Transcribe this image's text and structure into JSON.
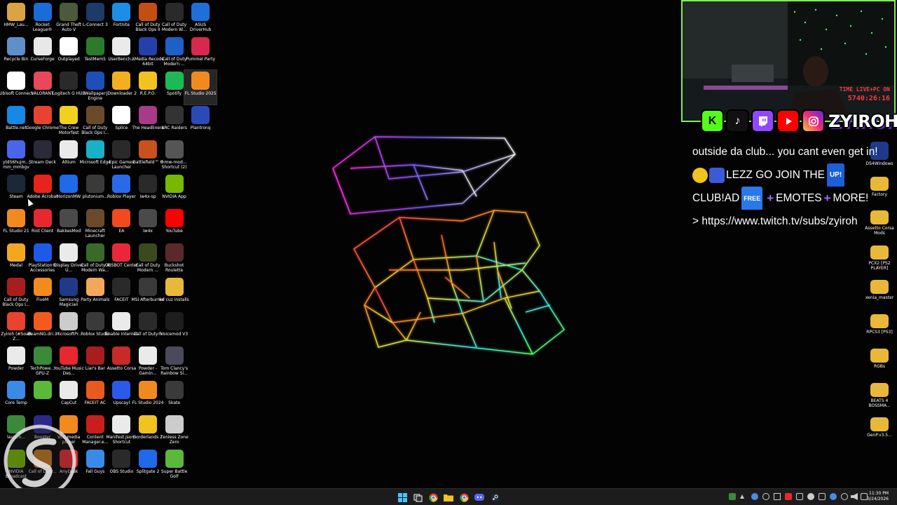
{
  "desktop_icons": [
    {
      "label": "HMW_Lau...",
      "icon": "folder-icon",
      "color": "#d9a441"
    },
    {
      "label": "Rocket League®",
      "icon": "rocket-league-icon",
      "color": "#1a6cd8"
    },
    {
      "label": "Grand Theft Auto V",
      "icon": "gta-icon",
      "color": "#4a5a3a"
    },
    {
      "label": "L-Connect 3",
      "icon": "lconnect-icon",
      "color": "#1e3a66"
    },
    {
      "label": "Fortnite",
      "icon": "fortnite-icon",
      "color": "#1b8fe8"
    },
    {
      "label": "Call of Duty Black Ops II",
      "icon": "cod-bo2-icon",
      "color": "#c44e12"
    },
    {
      "label": "Call of Duty Modern W...",
      "icon": "cod-mw-icon",
      "color": "#2a2a2a"
    },
    {
      "label": "ASUS DriverHub",
      "icon": "asus-icon",
      "color": "#1f6fd8"
    },
    {
      "label": "Recycle Bin",
      "icon": "recycle-bin-icon",
      "color": "#5f8fc8"
    },
    {
      "label": "CurseForge",
      "icon": "curseforge-icon",
      "color": "#e8e8e8"
    },
    {
      "label": "Outplayed",
      "icon": "outplayed-icon",
      "color": "#ffffff"
    },
    {
      "label": "TestMem5",
      "icon": "testmem-icon",
      "color": "#2d7a2d"
    },
    {
      "label": "UserBench...",
      "icon": "userbench-icon",
      "color": "#eaeaea"
    },
    {
      "label": "XMedia Recode 64bit",
      "icon": "xmedia-icon",
      "color": "#2540a8"
    },
    {
      "label": "Call of Duty Modern ...",
      "icon": "cod-icon",
      "color": "#1f5fc8"
    },
    {
      "label": "Pummel Party",
      "icon": "pummel-party-icon",
      "color": "#d8284f"
    },
    {
      "label": "Ubisoft Connect",
      "icon": "ubisoft-icon",
      "color": "#ffffff"
    },
    {
      "label": "VALORANT",
      "icon": "valorant-icon",
      "color": "#e8485a"
    },
    {
      "label": "Logitech G HUB",
      "icon": "ghub-icon",
      "color": "#2a2a2a"
    },
    {
      "label": "Wallpaper Engine",
      "icon": "wallpaper-engine-icon",
      "color": "#1e4fb8"
    },
    {
      "label": "JDownloader 2",
      "icon": "jdownloader-icon",
      "color": "#f2b01e"
    },
    {
      "label": "R.E.P.O.",
      "icon": "repo-icon",
      "color": "#f2c21e"
    },
    {
      "label": "Spotify",
      "icon": "spotify-icon",
      "color": "#1db954"
    },
    {
      "label": "FL Studio 2025",
      "icon": "fl-studio-icon",
      "color": "#f08a1e"
    },
    {
      "label": "Battle.net",
      "icon": "battlenet-icon",
      "color": "#1588e8"
    },
    {
      "label": "Google Chrome",
      "icon": "chrome-icon",
      "color": "#e8432e"
    },
    {
      "label": "The Crew Motorfest",
      "icon": "crew-icon",
      "color": "#f2d01e"
    },
    {
      "label": "Call of Duty Black Ops I...",
      "icon": "cod-bo-icon",
      "color": "#6a4a2a"
    },
    {
      "label": "Splice",
      "icon": "splice-icon",
      "color": "#ffffff"
    },
    {
      "label": "The Headliners",
      "icon": "headliners-icon",
      "color": "#a83a8a"
    },
    {
      "label": "ARC Raiders",
      "icon": "arc-raiders-icon",
      "color": "#333333"
    },
    {
      "label": "Plantronq",
      "icon": "plantronq-icon",
      "color": "#2a4ab8"
    },
    {
      "label": "ytd56hujm... mm_mmbgv",
      "icon": "folder-icon",
      "color": "#4a66e8"
    },
    {
      "label": "Stream Deck",
      "icon": "stream-deck-icon",
      "color": "#2a2a3a"
    },
    {
      "label": "Altium",
      "icon": "altium-icon",
      "color": "#eaeaea"
    },
    {
      "label": "Microsoft Edge",
      "icon": "edge-icon",
      "color": "#1ab0c8"
    },
    {
      "label": "Epic Games Launcher",
      "icon": "epic-icon",
      "color": "#2a2a2a"
    },
    {
      "label": "Battlefield™ 6",
      "icon": "battlefield-icon",
      "color": "#c8521e"
    },
    {
      "label": "hmw-mod... Shortcut (2)",
      "icon": "hmw-icon",
      "color": "#555555"
    },
    {
      "label": "Steam",
      "icon": "steam-icon",
      "color": "#1b2838"
    },
    {
      "label": "Adobe Acrobat",
      "icon": "acrobat-icon",
      "color": "#e8231e"
    },
    {
      "label": "HorizonMW",
      "icon": "horizon-icon",
      "color": "#1e6ae8"
    },
    {
      "label": "plutonium...",
      "icon": "plutonium-icon",
      "color": "#3a3a3a"
    },
    {
      "label": "Roblox Player",
      "icon": "roblox-icon",
      "color": "#2a6ae8"
    },
    {
      "label": "iw4x-sp",
      "icon": "iw4x-icon",
      "color": "#2a2a2a"
    },
    {
      "label": "NVIDIA App",
      "icon": "nvidia-icon",
      "color": "#76b900"
    },
    {
      "label": "FL Studio 21",
      "icon": "fl-studio-icon",
      "color": "#f08a1e"
    },
    {
      "label": "Riot Client",
      "icon": "riot-icon",
      "color": "#e8282e"
    },
    {
      "label": "BakkesMod",
      "icon": "bakkesmod-icon",
      "color": "#4a4a4a"
    },
    {
      "label": "Minecraft Launcher",
      "icon": "minecraft-icon",
      "color": "#6a4a2a"
    },
    {
      "label": "EA",
      "icon": "ea-icon",
      "color": "#f04a1e"
    },
    {
      "label": "iw4x",
      "icon": "iw4x-icon",
      "color": "#4a4a4a"
    },
    {
      "label": "YouTube",
      "icon": "youtube-icon",
      "color": "#ff0000"
    },
    {
      "label": "Medal",
      "icon": "medal-icon",
      "color": "#f2a81e"
    },
    {
      "label": "PlayStation® Accessories",
      "icon": "playstation-icon",
      "color": "#1e5ae8"
    },
    {
      "label": "Display Driver U...",
      "icon": "ddu-icon",
      "color": "#eaeaea"
    },
    {
      "label": "Call of Duty 4 Modern Wa...",
      "icon": "cod4-icon",
      "color": "#3a6a2a"
    },
    {
      "label": "OBSBOT Center",
      "icon": "obsbot-icon",
      "color": "#e8283a"
    },
    {
      "label": "Call of Duty Modern ...",
      "icon": "cod-icon",
      "color": "#3a4a1e"
    },
    {
      "label": "Buckshot Roulette",
      "icon": "buckshot-icon",
      "color": "#5a2a2a"
    },
    {
      "label": "Call of Duty Black Ops I...",
      "icon": "cod-bo-icon",
      "color": "#a81e1e"
    },
    {
      "label": "FiveM",
      "icon": "fivem-icon",
      "color": "#f28a1e"
    },
    {
      "label": "Samsung Magician",
      "icon": "samsung-icon",
      "color": "#1e3a88"
    },
    {
      "label": "Party Animals",
      "icon": "party-animals-icon",
      "color": "#f2a85a"
    },
    {
      "label": "FACEIT",
      "icon": "faceit-icon",
      "color": "#2a2a2a"
    },
    {
      "label": "MSI Afterburner",
      "icon": "msi-icon",
      "color": "#3a3a3a"
    },
    {
      "label": "kd cuz installs",
      "icon": "folder-icon",
      "color": "#e8b83a"
    },
    {
      "label": "Zyiroh (#SoaR Z...",
      "icon": "chrome-icon",
      "color": "#e8432e"
    },
    {
      "label": "BeamNG.dri...",
      "icon": "beamng-icon",
      "color": "#f25a1e"
    },
    {
      "label": "MicrosoftPr...",
      "icon": "ms-icon",
      "color": "#cccccc"
    },
    {
      "label": "Roblox Studio",
      "icon": "roblox-studio-icon",
      "color": "#3a3a3a"
    },
    {
      "label": "Enable Internet",
      "icon": "enable-internet-icon",
      "color": "#eaeaea"
    },
    {
      "label": "Call of Duty®",
      "icon": "cod-icon",
      "color": "#2a2a2a"
    },
    {
      "label": "Voicemod V3",
      "icon": "voicemod-icon",
      "color": "#1e1e1e"
    },
    {
      "label": "Powder",
      "icon": "powder-icon",
      "color": "#eaeaea"
    },
    {
      "label": "TechPowe... GPU-Z",
      "icon": "gpuz-icon",
      "color": "#3a8a3a"
    },
    {
      "label": "YouTube Music Des...",
      "icon": "yt-music-icon",
      "color": "#e8282e"
    },
    {
      "label": "Liar's Bar",
      "icon": "liars-bar-icon",
      "color": "#a81e1e"
    },
    {
      "label": "Assetto Corsa",
      "icon": "assetto-icon",
      "color": "#c82a2a"
    },
    {
      "label": "Powder - Gamin...",
      "icon": "powder-icon",
      "color": "#eaeaea"
    },
    {
      "label": "Tom Clancy's Rainbow Si...",
      "icon": "rainbow-six-icon",
      "color": "#4a4a5a"
    },
    {
      "label": "Core Temp",
      "icon": "core-temp-icon",
      "color": "#3a8ae8"
    },
    {
      "label": "",
      "icon": "app-icon",
      "color": "#5ab83a"
    },
    {
      "label": "CapCut",
      "icon": "capcut-icon",
      "color": "#eaeaea"
    },
    {
      "label": "FACEIT AC",
      "icon": "faceit-ac-icon",
      "color": "#e85a1e"
    },
    {
      "label": "Upscayl",
      "icon": "upscayl-icon",
      "color": "#2a5ae8"
    },
    {
      "label": "FL Studio 2024",
      "icon": "fl-studio-icon",
      "color": "#f08a1e"
    },
    {
      "label": "Skate",
      "icon": "skate-icon",
      "color": "#3a3a3a"
    },
    {
      "label": "launch...",
      "icon": "launcher-icon",
      "color": "#3a8a3a"
    },
    {
      "label": "Booster",
      "icon": "booster-icon",
      "color": "#2a2a8a"
    },
    {
      "label": "VLC media player",
      "icon": "vlc-icon",
      "color": "#f28a1e"
    },
    {
      "label": "Content Manager.e...",
      "icon": "content-manager-icon",
      "color": "#c81e1e"
    },
    {
      "label": "Manifest.json - Shortcut",
      "icon": "manifest-icon",
      "color": "#eaeaea"
    },
    {
      "label": "Borderlands 2",
      "icon": "borderlands-icon",
      "color": "#f2c21e"
    },
    {
      "label": "Zenless Zone Zero",
      "icon": "zzz-icon",
      "color": "#cccccc"
    },
    {
      "label": "NVIDIA Broadcast",
      "icon": "nvidia-broadcast-icon",
      "color": "#76b900"
    },
    {
      "label": "Call of Duty...",
      "icon": "cod-icon",
      "color": "#c87a1e"
    },
    {
      "label": "AnyDesk",
      "icon": "anydesk-icon",
      "color": "#e8282e"
    },
    {
      "label": "Fall Guys",
      "icon": "fall-guys-icon",
      "color": "#3a8ae8"
    },
    {
      "label": "OBS Studio",
      "icon": "obs-icon",
      "color": "#2a2a2a"
    },
    {
      "label": "Splitgate 2",
      "icon": "splitgate-icon",
      "color": "#1e6ae8"
    },
    {
      "label": "Super Battle Golf",
      "icon": "golf-icon",
      "color": "#5ab83a"
    }
  ],
  "right_icons": [
    {
      "label": "DS4Windows",
      "icon": "ds4-icon",
      "color": "#1e3a88"
    },
    {
      "label": "Factory",
      "icon": "folder-icon",
      "color": "#e8b83a"
    },
    {
      "label": "Assetto Corsa Mods",
      "icon": "folder-icon",
      "color": "#e8b83a"
    },
    {
      "label": "PCX2 [PS2 PLAYER]",
      "icon": "folder-icon",
      "color": "#e8b83a"
    },
    {
      "label": "xenia_master",
      "icon": "folder-icon",
      "color": "#e8b83a"
    },
    {
      "label": "RPCS3 [PS3]",
      "icon": "folder-icon",
      "color": "#e8b83a"
    },
    {
      "label": "RGBs",
      "icon": "folder-icon",
      "color": "#e8b83a"
    },
    {
      "label": "BEATS 4 BOSSMA...",
      "icon": "folder-icon",
      "color": "#e8b83a"
    },
    {
      "label": "GenP.v3.5...",
      "icon": "folder-icon",
      "color": "#e8b83a"
    }
  ],
  "webcam": {
    "overlay_line1": "TIME LIVE+PC ON",
    "overlay_line2": "5740:26:16"
  },
  "socials": {
    "kick_letter": "K",
    "tiktok_letter": "♪",
    "handle": "ZYIROH"
  },
  "chat": {
    "line1": "outside da club... you cant even get in!",
    "line2_text": "LEZZ GO JOIN THE",
    "line2_badge": "UP!",
    "line3_a": "CLUB!AD",
    "line3_badge": "FREE",
    "line3_b": "EMOTES",
    "line3_c": "MORE!",
    "line4": "> https://www.twitch.tv/subs/zyiroh"
  },
  "taskbar": {
    "time": "11:30 PM",
    "date": "3/24/2026",
    "pinned": [
      "start-icon",
      "taskview-icon",
      "chrome-icon",
      "file-explorer-icon",
      "chrome-icon",
      "discord-icon",
      "steam-icon"
    ]
  },
  "colors": {
    "accent_green": "#7ef04d",
    "twitch_purple": "#9146ff",
    "youtube_red": "#ff0000",
    "instagram_pink": "#d62976"
  }
}
